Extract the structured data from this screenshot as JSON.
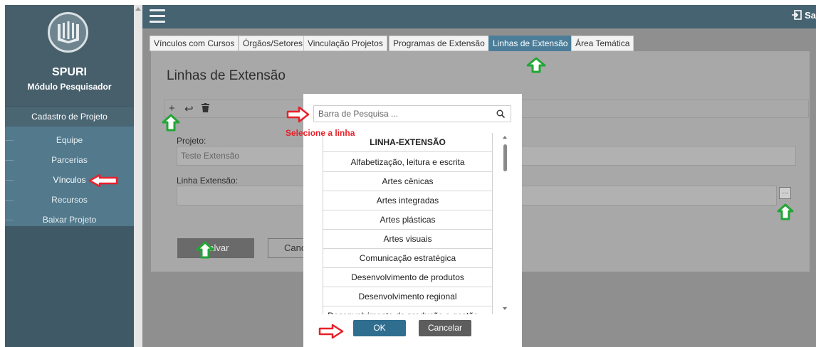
{
  "sidebar": {
    "app_name": "SPURI",
    "module": "Módulo Pesquisador",
    "menu_header": "Cadastro de Projeto",
    "items": [
      {
        "label": "Equipe"
      },
      {
        "label": "Parcerias"
      },
      {
        "label": "Vínculos"
      },
      {
        "label": "Recursos"
      },
      {
        "label": "Baixar Projeto"
      }
    ]
  },
  "header": {
    "exit_label": "Sa"
  },
  "tabs": [
    {
      "label": "Vínculos com Cursos"
    },
    {
      "label": "Órgãos/Setores"
    },
    {
      "label": "Vinculação Projetos"
    },
    {
      "label": "Programas de Extensão"
    },
    {
      "label": "Linhas de Extensão"
    },
    {
      "label": "Área Temática"
    }
  ],
  "form": {
    "title": "Linhas de Extensão",
    "projeto_label": "Projeto:",
    "projeto_value": "Teste Extensão",
    "linha_label": "Linha Extensão:",
    "linha_value": "",
    "ellipsis": "...",
    "save_label": "Salvar",
    "cancel_partial": "Canc"
  },
  "modal": {
    "search_placeholder": "Barra de Pesquisa ...",
    "column_header": "LINHA-EXTENSÃO",
    "rows": [
      "Alfabetização, leitura e escrita",
      "Artes cênicas",
      "Artes integradas",
      "Artes plásticas",
      "Artes visuais",
      "Comunicação estratégica",
      "Desenvolvimento de produtos",
      "Desenvolvimento regional",
      "Desenvolvimento de produção e gestão ..."
    ],
    "ok_label": "OK",
    "cancel_label": "Cancelar"
  },
  "annotation": {
    "note": "Selecione a linha"
  },
  "colors": {
    "green_arrow": "#22a636",
    "red_arrow": "#e8202a",
    "active_tab": "#4b7d99"
  }
}
